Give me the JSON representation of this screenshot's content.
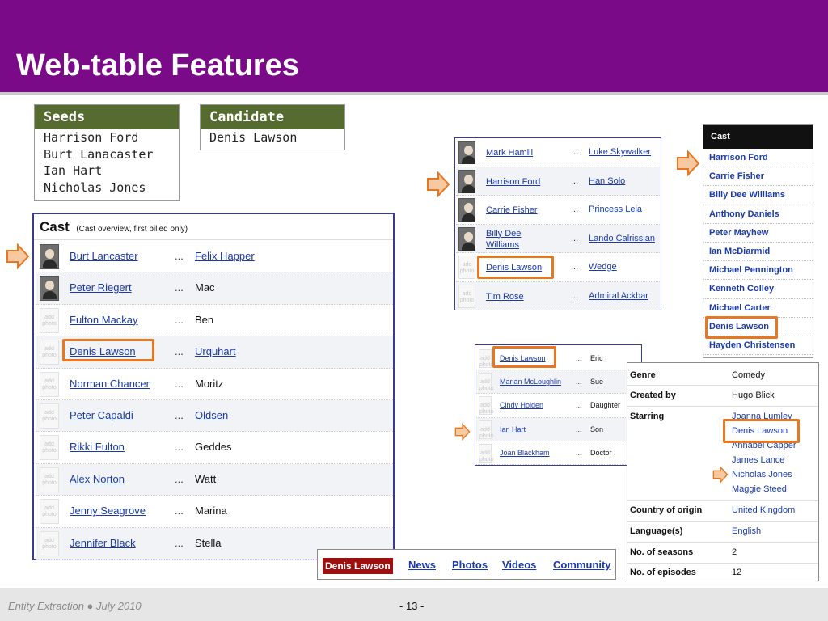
{
  "slide": {
    "title": "Web-table Features",
    "footer_left": "Entity Extraction ● July 2010",
    "page_number": "- 13 -"
  },
  "seeds": {
    "header": "Seeds",
    "items": [
      "Harrison Ford",
      "Burt Lanacaster",
      "Ian Hart",
      "Nicholas Jones"
    ]
  },
  "candidate": {
    "header": "Candidate",
    "items": [
      "Denis Lawson"
    ]
  },
  "cast_main": {
    "title": "Cast",
    "subtitle": "(Cast overview, first billed only)",
    "photo_placeholder": "add photo",
    "dots": "...",
    "rows": [
      {
        "actor": "Burt Lancaster",
        "role": "Felix Happer",
        "role_link": true,
        "has_photo": true
      },
      {
        "actor": "Peter Riegert",
        "role": "Mac",
        "role_link": false,
        "has_photo": true
      },
      {
        "actor": "Fulton Mackay",
        "role": "Ben",
        "role_link": false,
        "has_photo": false
      },
      {
        "actor": "Denis Lawson",
        "role": "Urquhart",
        "role_link": true,
        "has_photo": false
      },
      {
        "actor": "Norman Chancer",
        "role": "Moritz",
        "role_link": false,
        "has_photo": false
      },
      {
        "actor": "Peter Capaldi",
        "role": "Oldsen",
        "role_link": true,
        "has_photo": false
      },
      {
        "actor": "Rikki Fulton",
        "role": "Geddes",
        "role_link": false,
        "has_photo": false
      },
      {
        "actor": "Alex Norton",
        "role": "Watt",
        "role_link": false,
        "has_photo": false
      },
      {
        "actor": "Jenny Seagrove",
        "role": "Marina",
        "role_link": false,
        "has_photo": false
      },
      {
        "actor": "Jennifer Black",
        "role": "Stella",
        "role_link": false,
        "has_photo": false
      }
    ]
  },
  "cast_small_1": {
    "rows": [
      {
        "actor": "Mark Hamill",
        "role": "Luke Skywalker",
        "has_photo": true
      },
      {
        "actor": "Harrison Ford",
        "role": "Han Solo",
        "has_photo": true
      },
      {
        "actor": "Carrie Fisher",
        "role": "Princess Leia",
        "has_photo": true
      },
      {
        "actor": "Billy Dee Williams",
        "role": "Lando Calrissian",
        "has_photo": true
      },
      {
        "actor": "Denis Lawson",
        "role": "Wedge",
        "has_photo": false
      },
      {
        "actor": "Tim Rose",
        "role": "Admiral Ackbar",
        "has_photo": false
      }
    ]
  },
  "cast_list": {
    "header": "Cast",
    "items": [
      "Harrison Ford",
      "Carrie Fisher",
      "Billy Dee Williams",
      "Anthony Daniels",
      "Peter Mayhew",
      "Ian McDiarmid",
      "Michael Pennington",
      "Kenneth Colley",
      "Michael Carter",
      "Denis Lawson",
      "Hayden Christensen"
    ]
  },
  "cast_small_2": {
    "rows": [
      {
        "actor": "Denis Lawson",
        "role": "Eric"
      },
      {
        "actor": "Marian McLoughlin",
        "role": "Sue"
      },
      {
        "actor": "Cindy Holden",
        "role": "Daughter"
      },
      {
        "actor": "Ian Hart",
        "role": "Son"
      },
      {
        "actor": "Joan Blackham",
        "role": "Doctor"
      }
    ]
  },
  "infobox": {
    "genre_label": "Genre",
    "genre": "Comedy",
    "created_label": "Created by",
    "created": "Hugo Blick",
    "starring_label": "Starring",
    "starring": [
      "Joanna Lumley",
      "Denis Lawson",
      "Annabel Capper",
      "James Lance",
      "Nicholas Jones",
      "Maggie Steed"
    ],
    "country_label": "Country of origin",
    "country": "United Kingdom",
    "language_label": "Language(s)",
    "language": "English",
    "seasons_label": "No. of seasons",
    "seasons": "2",
    "episodes_label": "No. of episodes",
    "episodes": "12"
  },
  "tabs": {
    "active": "Denis Lawson",
    "items": [
      "News",
      "Photos",
      "Videos",
      "Community"
    ]
  },
  "colors": {
    "header": "#7a0a88",
    "highlight": "#e87722",
    "link": "#1a3aa8",
    "seed_header": "#556b2f"
  }
}
